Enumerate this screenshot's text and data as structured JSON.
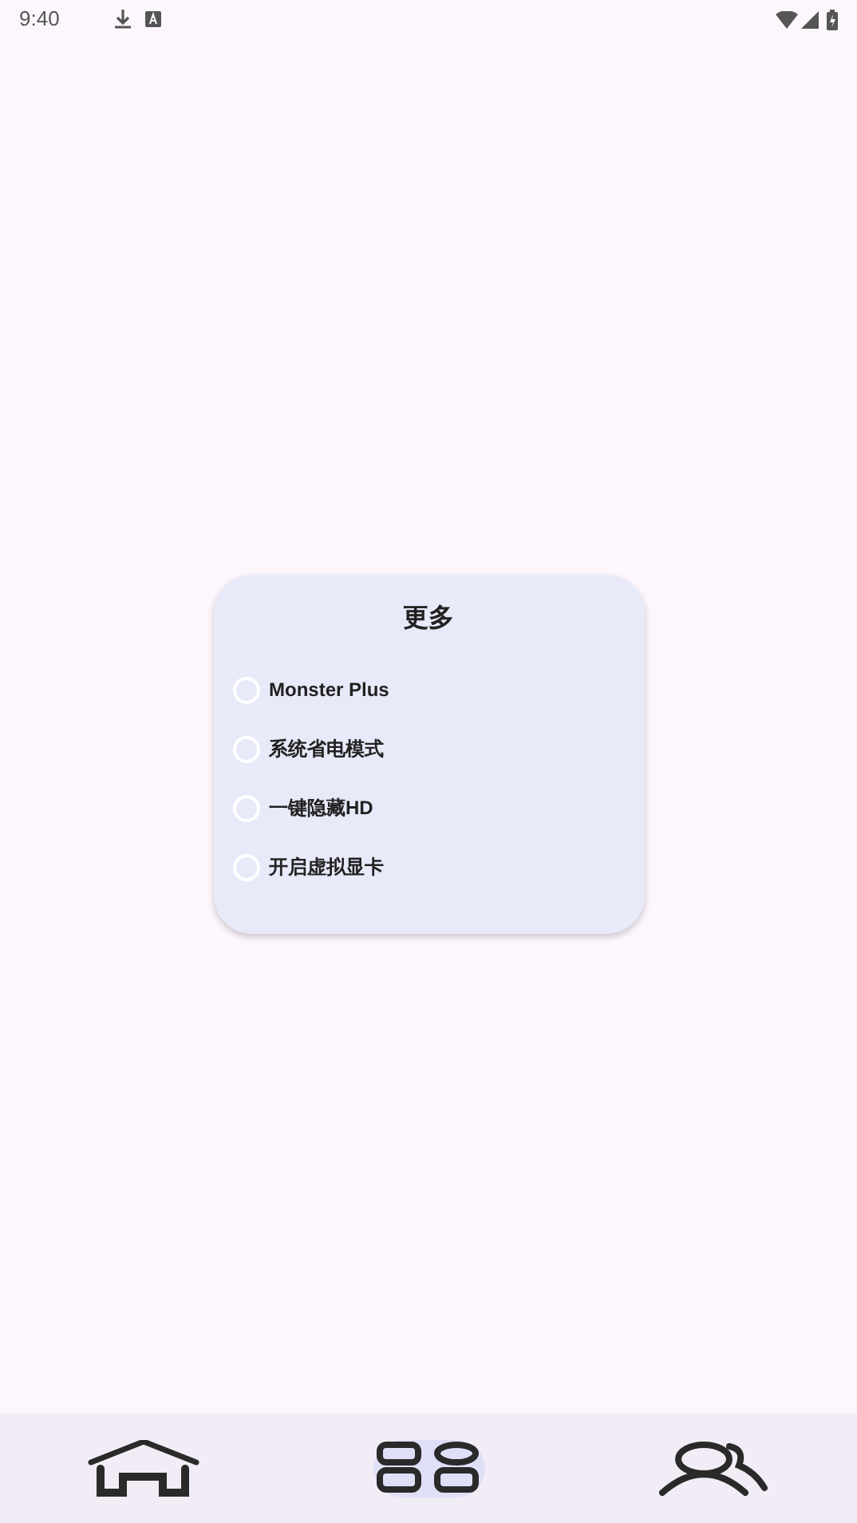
{
  "status_bar": {
    "time": "9:40"
  },
  "dialog": {
    "title": "更多",
    "options": [
      {
        "label": "Monster Plus",
        "checked": false
      },
      {
        "label": "系统省电模式",
        "checked": false
      },
      {
        "label": "一键隐藏HD",
        "checked": false
      },
      {
        "label": "开启虚拟显卡",
        "checked": false
      }
    ]
  },
  "bottom_nav": [
    {
      "kind": "home",
      "selected": false
    },
    {
      "kind": "grid",
      "selected": true
    },
    {
      "kind": "people",
      "selected": false
    }
  ]
}
